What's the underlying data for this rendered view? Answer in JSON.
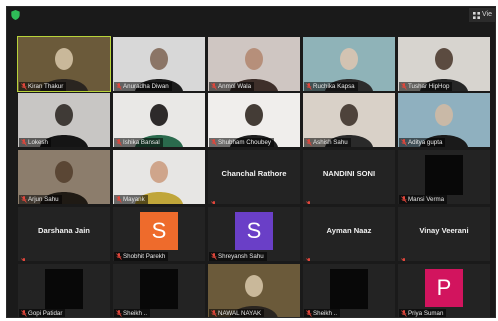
{
  "toolbar": {
    "view_label": "Vie"
  },
  "colors": {
    "active_border": "#b8d33a",
    "mic_muted": "#e0463b",
    "avatar_orange": "#ee6b2c",
    "avatar_purple": "#6a3fc7",
    "avatar_pink": "#d2145e"
  },
  "tiles": [
    {
      "label": "Kiran Thakur",
      "kind": "video",
      "active": true
    },
    {
      "label": "Anuradha Diwan",
      "kind": "video"
    },
    {
      "label": "Anmol Wala",
      "kind": "video"
    },
    {
      "label": "Ruchika Kapsa",
      "kind": "video"
    },
    {
      "label": "Tushar HipHop",
      "kind": "video"
    },
    {
      "label": "Lokesh",
      "kind": "video"
    },
    {
      "label": "Ishika Bansal",
      "kind": "video"
    },
    {
      "label": "Shubham Choubey",
      "kind": "video"
    },
    {
      "label": "Ashish Sahu",
      "kind": "video"
    },
    {
      "label": "Aditya gupta",
      "kind": "video"
    },
    {
      "label": "Arjun Sahu",
      "kind": "video"
    },
    {
      "label": "Mayank",
      "kind": "video"
    },
    {
      "label": "",
      "big_name": "Chanchal Rathore",
      "kind": "name"
    },
    {
      "label": "",
      "big_name": "NANDINI SONI",
      "kind": "name"
    },
    {
      "label": "Mansi Verma",
      "kind": "dark"
    },
    {
      "label": "",
      "big_name": "Darshana Jain",
      "kind": "name"
    },
    {
      "label": "Shobhit Parekh",
      "kind": "avatar",
      "letter": "S",
      "color": "#ee6b2c"
    },
    {
      "label": "Shreyansh Sahu",
      "kind": "avatar",
      "letter": "S",
      "color": "#6a3fc7"
    },
    {
      "label": "",
      "big_name": "Ayman Naaz",
      "kind": "name"
    },
    {
      "label": "",
      "big_name": "Vinay Veerani",
      "kind": "name"
    },
    {
      "label": "Gopi Patidar",
      "kind": "dark"
    },
    {
      "label": "Sheikh ..",
      "kind": "dark"
    },
    {
      "label": "NAWAL NAYAK",
      "kind": "video"
    },
    {
      "label": "Sheikh ..",
      "kind": "dark"
    },
    {
      "label": "Priya Suman",
      "kind": "avatar",
      "letter": "P",
      "color": "#d2145e"
    }
  ]
}
